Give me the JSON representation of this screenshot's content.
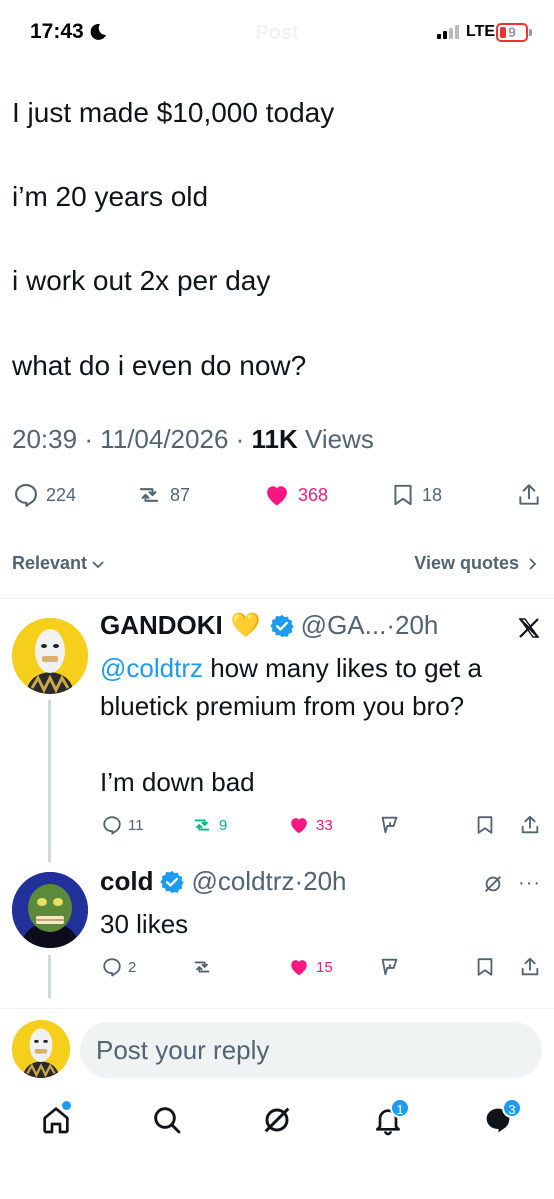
{
  "status_bar": {
    "time": "17:43",
    "network": "LTE",
    "battery": "9",
    "header_title": "Post"
  },
  "tweet": {
    "lines": [
      "I just made $10,000 today",
      "i’m 20 years old",
      "i work out 2x per day",
      "what do i even do now?"
    ],
    "time": "20:39",
    "date": "11/04/2026",
    "views_count": "11K",
    "views_label": "Views",
    "replies": "224",
    "reposts": "87",
    "likes": "368",
    "bookmarks": "18"
  },
  "sort": {
    "label": "Relevant",
    "view_quotes": "View quotes"
  },
  "replies": [
    {
      "name": "GANDOKI",
      "emoji": "💛",
      "handle": "@GA...",
      "age": "20h",
      "mention": "@coldtrz",
      "text_lines": [
        "how many likes to get a",
        "bluetick premium from you bro?",
        "",
        "I’m down bad"
      ],
      "replies": "11",
      "reposts": "9",
      "likes": "33",
      "colors": {
        "repost": "#00ba7c",
        "like": "#f91880"
      }
    },
    {
      "name": "cold",
      "handle": "@coldtrz",
      "age": "20h",
      "text": "30 likes",
      "replies": "2",
      "reposts": "",
      "likes": "15"
    }
  ],
  "reply_bar": {
    "placeholder": "Post your reply"
  },
  "tabbar": {
    "notifications_badge": "1",
    "messages_badge": "3"
  },
  "colors": {
    "accent": "#1d9bf0",
    "like": "#f91880",
    "repost": "#00ba7c",
    "text": "#0f1419",
    "muted": "#536471"
  }
}
